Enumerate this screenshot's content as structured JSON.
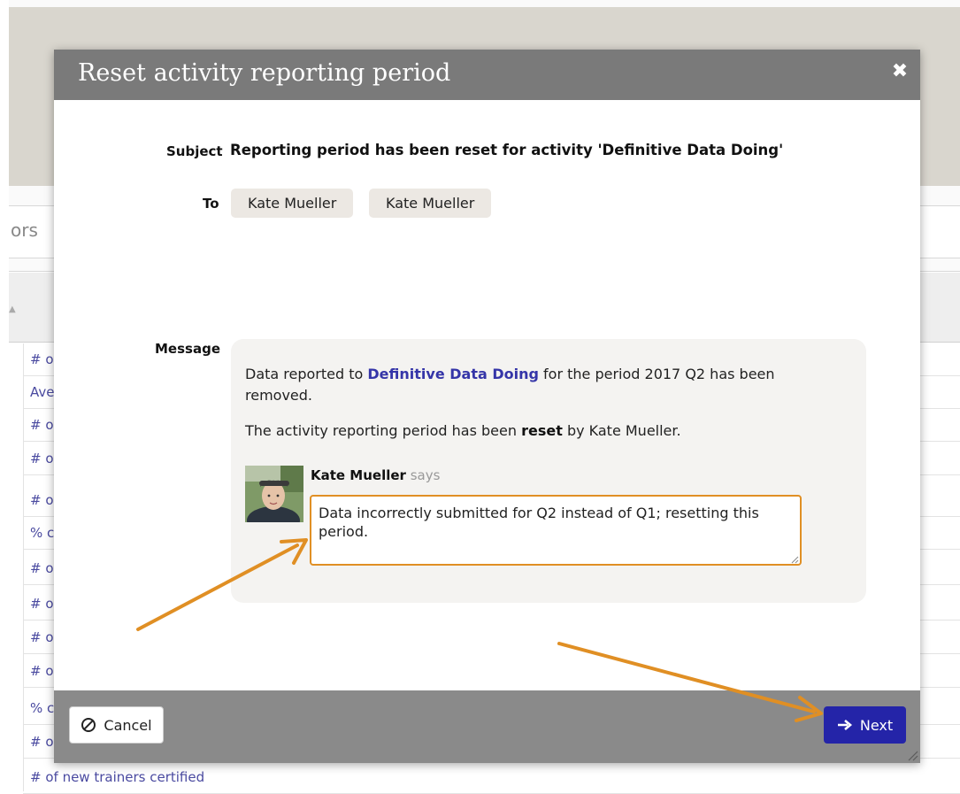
{
  "background": {
    "tab_fragment": "ors",
    "rows": [
      "# o",
      "Ave",
      "# o",
      "# o",
      "# o",
      "% c",
      "# o",
      "# o",
      "# o",
      "# o",
      "% c",
      "# o"
    ],
    "last_row": "# of new trainers certified"
  },
  "modal": {
    "title": "Reset activity reporting period",
    "subject_label": "Subject",
    "subject_value": "Reporting period has been reset for activity 'Definitive Data Doing'",
    "to_label": "To",
    "recipients": [
      "Kate Mueller",
      "Kate Mueller"
    ],
    "message_label": "Message",
    "message": {
      "line1_prefix": "Data reported to ",
      "activity_link": "Definitive Data Doing",
      "line1_suffix": " for the period 2017 Q2 has been",
      "line1_wrap": "removed.",
      "line2_prefix": "The activity reporting period has been ",
      "line2_bold": "reset",
      "line2_suffix": " by Kate Mueller.",
      "author_name": "Kate Mueller",
      "author_says": "says",
      "comment": "Data incorrectly submitted for Q2 instead of Q1; resetting this period."
    },
    "footer": {
      "cancel_label": "Cancel",
      "next_label": "Next"
    }
  },
  "colors": {
    "header_bg": "#7a7a7a",
    "footer_bg": "#8a8a8a",
    "primary_button": "#2424a8",
    "link": "#3535a8",
    "highlight": "#e08f24"
  },
  "icons": {
    "close": "close-icon",
    "cancel": "ban-icon",
    "next": "arrow-right-icon"
  }
}
